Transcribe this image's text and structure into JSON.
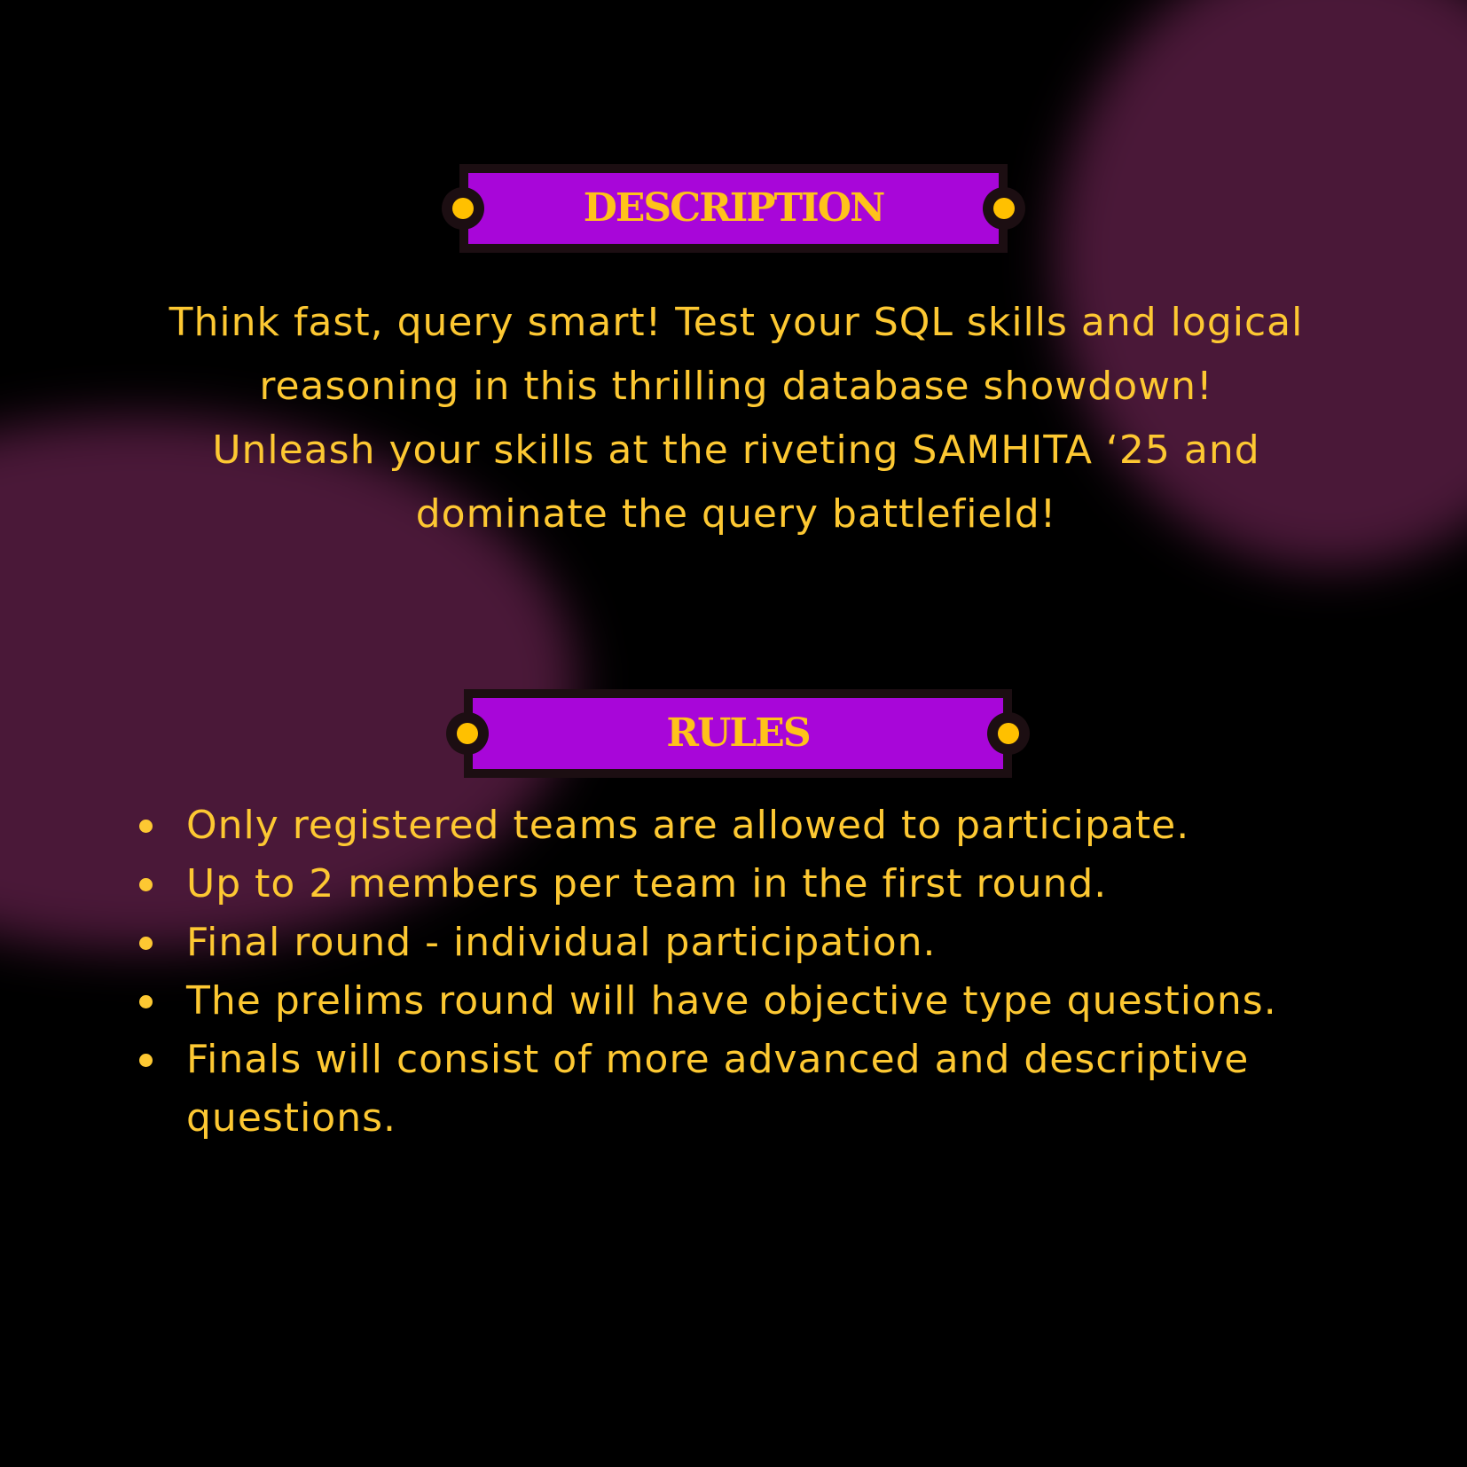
{
  "colors": {
    "background": "#000000",
    "glow": "#4a1838",
    "banner_fill": "#a806d9",
    "banner_frame": "#1c0e12",
    "accent_text": "#fdc832",
    "rivet": "#ffc000"
  },
  "description_section": {
    "title": "DESCRIPTION",
    "lines": [
      "Think fast, query smart! Test your SQL skills and logical",
      "reasoning in this thrilling database showdown!",
      "Unleash your skills at the riveting SAMHITA ‘25 and",
      "dominate the query battlefield!"
    ]
  },
  "rules_section": {
    "title": "RULES",
    "items": [
      "Only registered teams are allowed to participate.",
      "Up to 2 members per team in the first round.",
      "Final round - individual participation.",
      "The prelims round will have objective type questions.",
      "Finals will consist of more advanced and descriptive questions."
    ]
  }
}
